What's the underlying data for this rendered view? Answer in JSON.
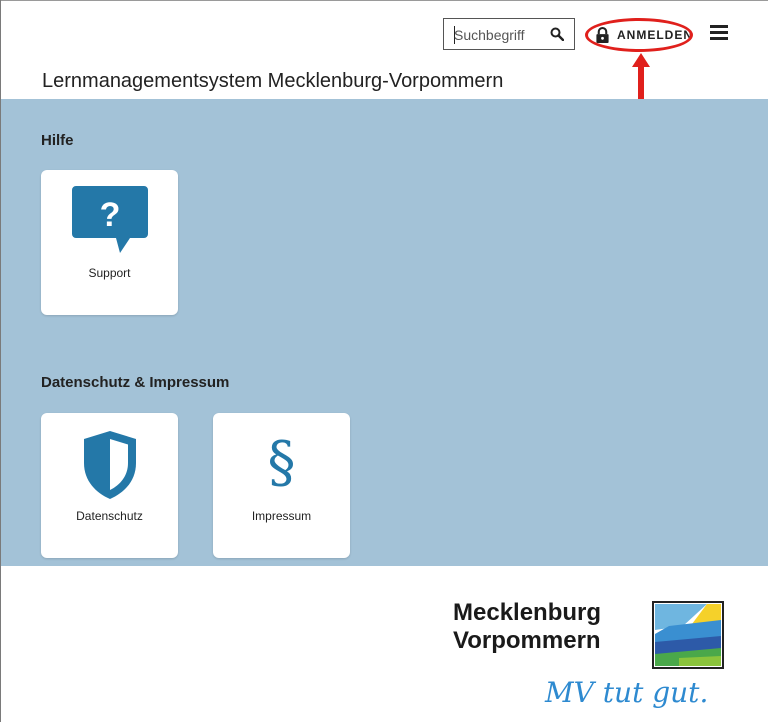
{
  "header": {
    "search": {
      "placeholder": "Suchbegriff",
      "icon": "search-icon"
    },
    "login_label": "ANMELDEN",
    "login_icon": "lock-icon",
    "menu_icon": "hamburger-menu-icon",
    "site_title": "Lernmanagementsystem Mecklenburg-Vorpommern"
  },
  "sections": [
    {
      "title": "Hilfe",
      "tiles": [
        {
          "label": "Support",
          "icon": "question-chat-icon"
        }
      ]
    },
    {
      "title": "Datenschutz & Impressum",
      "tiles": [
        {
          "label": "Datenschutz",
          "icon": "shield-icon"
        },
        {
          "label": "Impressum",
          "icon": "paragraph-icon",
          "glyph": "§"
        }
      ]
    }
  ],
  "footer": {
    "logo_line1": "Mecklenburg",
    "logo_line2": "Vorpommern",
    "slogan": "MV tut gut."
  },
  "colors": {
    "main_bg": "#a3c2d7",
    "icon_blue": "#2478a8",
    "annotation_red": "#e0201c",
    "slogan_blue": "#2e8ad0"
  }
}
